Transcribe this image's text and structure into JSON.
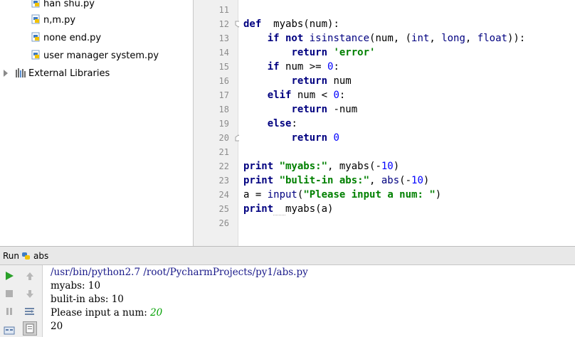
{
  "project_tree": {
    "files": [
      "han shu.py",
      "n,m.py",
      "none end.py",
      "user manager system.py"
    ],
    "external_libraries": "External Libraries"
  },
  "editor": {
    "line_numbers": [
      "11",
      "12",
      "13",
      "14",
      "15",
      "16",
      "17",
      "18",
      "19",
      "20",
      "21",
      "22",
      "23",
      "24",
      "25",
      "26"
    ],
    "lines": [
      [],
      [
        [
          "kw",
          "def"
        ],
        [
          "",
          "  "
        ],
        [
          "",
          "myabs(num):"
        ]
      ],
      [
        [
          "",
          "    "
        ],
        [
          "kw",
          "if not "
        ],
        [
          "bi",
          "isinstance"
        ],
        [
          "",
          "(num, ("
        ],
        [
          "bi",
          "int"
        ],
        [
          "",
          ", "
        ],
        [
          "bi",
          "long"
        ],
        [
          "",
          ", "
        ],
        [
          "bi",
          "float"
        ],
        [
          "",
          "))"
        ],
        [
          "",
          ":"
        ]
      ],
      [
        [
          "",
          "        "
        ],
        [
          "kw",
          "return "
        ],
        [
          "str",
          "'error'"
        ]
      ],
      [
        [
          "",
          "    "
        ],
        [
          "kw",
          "if "
        ],
        [
          "",
          "num >= "
        ],
        [
          "num",
          "0"
        ],
        [
          "",
          ":"
        ]
      ],
      [
        [
          "",
          "        "
        ],
        [
          "kw",
          "return "
        ],
        [
          "",
          "num"
        ]
      ],
      [
        [
          "",
          "    "
        ],
        [
          "kw",
          "elif "
        ],
        [
          "",
          "num < "
        ],
        [
          "num",
          "0"
        ],
        [
          "",
          ":"
        ]
      ],
      [
        [
          "",
          "        "
        ],
        [
          "kw",
          "return "
        ],
        [
          "",
          "-num"
        ]
      ],
      [
        [
          "",
          "    "
        ],
        [
          "kw",
          "else"
        ],
        [
          "",
          ":"
        ]
      ],
      [
        [
          "",
          "        "
        ],
        [
          "kw",
          "return "
        ],
        [
          "num",
          "0"
        ]
      ],
      [],
      [
        [
          "kw",
          "print "
        ],
        [
          "str",
          "\"myabs:\""
        ],
        [
          "",
          ", myabs(-"
        ],
        [
          "num",
          "10"
        ],
        [
          "",
          ")"
        ]
      ],
      [
        [
          "kw",
          "print "
        ],
        [
          "str",
          "\"bulit-in abs:\""
        ],
        [
          "",
          ", "
        ],
        [
          "bi",
          "abs"
        ],
        [
          "",
          "(-"
        ],
        [
          "num",
          "10"
        ],
        [
          "",
          ")"
        ]
      ],
      [
        [
          "",
          "a = "
        ],
        [
          "bi",
          "input"
        ],
        [
          "",
          "("
        ],
        [
          "str",
          "\"Please input a num: \""
        ],
        [
          "",
          ")"
        ]
      ],
      [
        [
          "kw",
          "print"
        ],
        [
          "squig",
          "  "
        ],
        [
          "",
          "myabs(a)"
        ]
      ],
      []
    ]
  },
  "run_panel": {
    "label": "Run",
    "config_name": "abs",
    "console": {
      "path_line": "/usr/bin/python2.7 /root/PycharmProjects/py1/abs.py",
      "out1": "myabs: 10",
      "out2": "bulit-in abs: 10",
      "prompt": "Please input a num: ",
      "user_input": "20",
      "out3": "20"
    }
  },
  "colors": {
    "run_green": "#2aa12a",
    "keyword": "#000080",
    "string": "#008000",
    "number": "#0000ff"
  }
}
